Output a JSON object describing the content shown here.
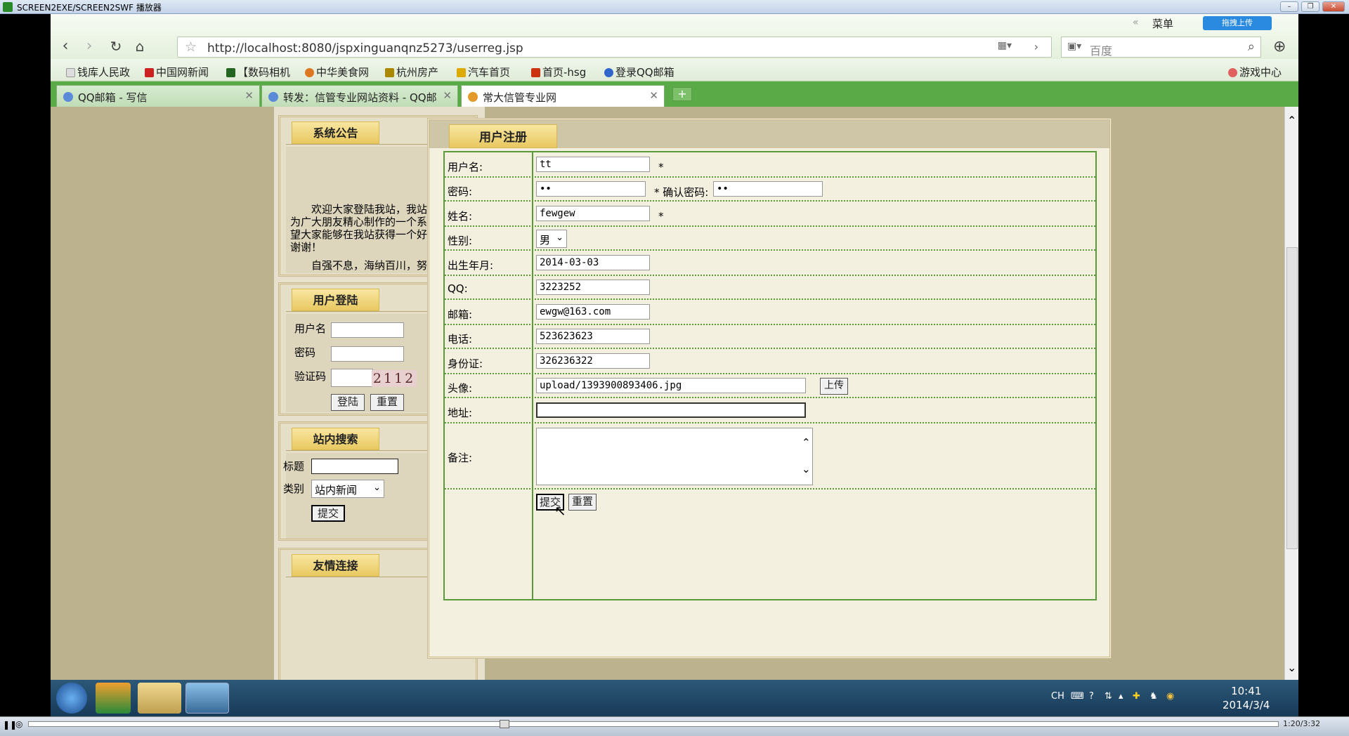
{
  "player": {
    "title": "SCREEN2EXE/SCREEN2SWF 播放器",
    "time": "1:20/3:32"
  },
  "browser": {
    "url": "http://localhost:8080/jspxinguanqnz5273/userreg.jsp",
    "menu_label": "菜单",
    "upload_badge": "拖拽上传",
    "search_placeholder": "百度",
    "bookmarks": [
      {
        "label": "钱库人民政",
        "color": "#8888cc"
      },
      {
        "label": "中国网新闻",
        "color": "#cc2222"
      },
      {
        "label": "【数码相机",
        "color": "#226622"
      },
      {
        "label": "中华美食网",
        "color": "#dd7722"
      },
      {
        "label": "杭州房产",
        "color": "#aa8800"
      },
      {
        "label": "汽车首页",
        "color": "#ddaa00"
      },
      {
        "label": "首页-hsg",
        "color": "#cc3311"
      },
      {
        "label": "登录QQ邮箱",
        "color": "#3366cc"
      }
    ],
    "game_center": "游戏中心",
    "tabs": [
      {
        "label": "QQ邮箱 - 写信"
      },
      {
        "label": "转发：信管专业网站资料 - QQ邮"
      },
      {
        "label": "常大信管专业网"
      }
    ]
  },
  "sidebar": {
    "notice_title": "系统公告",
    "notice_text": "欢迎大家登陆我站，我站主要是为广大朋友精心制作的一个系统，希望大家能够在我站获得一个好心情，谢谢！",
    "notice_text2": "自强不息，海纳百川，努力学习",
    "login_title": "用户登陆",
    "login_user_label": "用户名",
    "login_pass_label": "密码",
    "login_captcha_label": "验证码",
    "captcha_text": "2112",
    "login_button": "登陆",
    "reset_button": "重置",
    "search_title": "站内搜索",
    "search_title_label": "标题",
    "search_category_label": "类别",
    "search_category_value": "站内新闻",
    "search_submit": "提交",
    "links_title": "友情连接"
  },
  "form": {
    "title": "用户注册",
    "username_label": "用户名:",
    "username_value": "tt",
    "password_label": "密码:",
    "password_value": "••",
    "confirm_label": "* 确认密码:",
    "confirm_value": "••",
    "name_label": "姓名:",
    "name_value": "fewgew",
    "gender_label": "性别:",
    "gender_value": "男",
    "birth_label": "出生年月:",
    "birth_value": "2014-03-03",
    "qq_label": "QQ:",
    "qq_value": "3223252",
    "email_label": "邮箱:",
    "email_value": "ewgw@163.com",
    "phone_label": "电话:",
    "phone_value": "523623623",
    "idcard_label": "身份证:",
    "idcard_value": "326236322",
    "avatar_label": "头像:",
    "avatar_value": "upload/1393900893406.jpg",
    "upload_button": "上传",
    "address_label": "地址:",
    "address_value": "",
    "remark_label": "备注:",
    "remark_value": "",
    "submit_button": "提交",
    "reset_button": "重置",
    "required_mark": "*"
  },
  "taskbar": {
    "lang": "CH",
    "time": "10:41",
    "date": "2014/3/4"
  }
}
